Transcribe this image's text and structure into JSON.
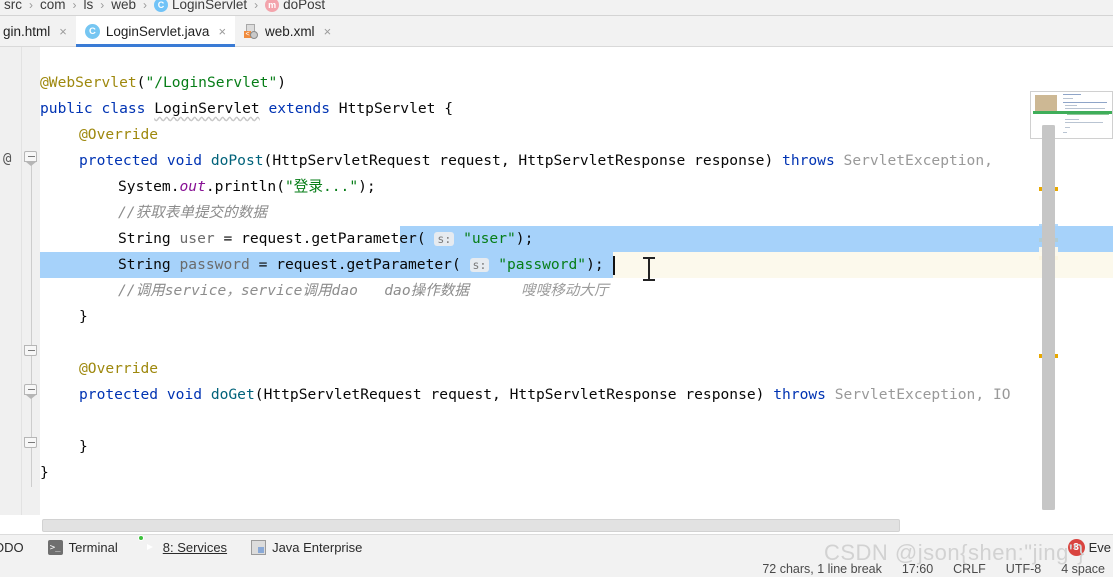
{
  "breadcrumb": {
    "items": [
      {
        "label": "src",
        "icon": "none"
      },
      {
        "label": "com",
        "icon": "none"
      },
      {
        "label": "ls",
        "icon": "none"
      },
      {
        "label": "web",
        "icon": "none"
      },
      {
        "label": "LoginServlet",
        "icon": "class-icon",
        "glyph": "C"
      },
      {
        "label": "doPost",
        "icon": "method-icon",
        "glyph": "m"
      }
    ],
    "separator": "›"
  },
  "tabs": [
    {
      "label": "gin.html",
      "icon": "html-file-icon",
      "active": false,
      "close": "×"
    },
    {
      "label": "LoginServlet.java",
      "icon": "java-class-icon",
      "glyph": "C",
      "active": true,
      "close": "×"
    },
    {
      "label": "web.xml",
      "icon": "xml-file-icon",
      "active": false,
      "close": "×"
    }
  ],
  "editor": {
    "annotation_marker": "@",
    "code_lines": [
      "@WebServlet(\"/LoginServlet\")",
      "public class LoginServlet extends HttpServlet {",
      "    @Override",
      "    protected void doPost(HttpServletRequest request, HttpServletResponse response) throws ServletException,",
      "        System.out.println(\"登录...\");",
      "        //获取表单提交的数据",
      "        String user = request.getParameter( s: \"user\");",
      "        String password = request.getParameter( s: \"password\");",
      "        //调用service，service调用dao   dao操作数据",
      "    }",
      "",
      "    @Override",
      "    protected void doGet(HttpServletRequest request, HttpServletResponse response) throws ServletException, IO",
      "",
      "    }",
      "}"
    ],
    "tokens": {
      "annotation_webservlet": "@WebServlet",
      "annotation_override": "@Override",
      "kw_public": "public",
      "kw_class": "class",
      "kw_extends": "extends",
      "kw_protected": "protected",
      "kw_void": "void",
      "kw_throws": "throws",
      "type_loginservlet": "LoginServlet",
      "type_httpservlet": "HttpServlet",
      "type_httpservletrequest": "HttpServletRequest",
      "type_httpservletresponse": "HttpServletResponse",
      "type_servletexception": "ServletException",
      "type_io_truncated": "IO",
      "type_servletexception_truncated_dopost": "ServletException,",
      "method_dopost": "doPost",
      "method_doget": "doGet",
      "method_getparameter": "getParameter",
      "method_println": "println",
      "var_request": "request",
      "var_response": "response",
      "var_user": "user",
      "var_password": "password",
      "var_system": "System",
      "field_out": "out",
      "type_string": "String",
      "str_path": "\"/LoginServlet\"",
      "str_login": "\"登录...\"",
      "str_user": "\"user\"",
      "str_password": "\"password\"",
      "hint_s": "s:",
      "comment_get_form": "//获取表单提交的数据",
      "comment_call_service": "//调用service，service调用dao   dao操作数据",
      "inlay_hint_extra": "嗖嗖移动大厅",
      "brace_open": "{",
      "brace_close": "}",
      "paren_open": "(",
      "paren_close": ")",
      "semicolon": ";",
      "comma": ",",
      "dot": ".",
      "equals": "="
    }
  },
  "toolbar": {
    "items": [
      {
        "label": "ODO",
        "icon": "todo-icon",
        "mnemonic": ""
      },
      {
        "label": "Terminal",
        "icon": "terminal-icon",
        "mnemonic": ""
      },
      {
        "label": "8: Services",
        "icon": "services-run-icon",
        "mnemonic": "8"
      },
      {
        "label": "Java Enterprise",
        "icon": "java-enterprise-icon",
        "mnemonic": ""
      }
    ],
    "right": {
      "event_log_label": "Eve",
      "badge_count": "3"
    }
  },
  "statusbar": {
    "items": [
      {
        "name": "selection-info",
        "value": "72 chars, 1 line break"
      },
      {
        "name": "caret-position",
        "value": "17:60"
      },
      {
        "name": "line-separator",
        "value": "CRLF"
      },
      {
        "name": "file-encoding",
        "value": "UTF-8"
      },
      {
        "name": "indent",
        "value": "4 space"
      }
    ]
  },
  "watermark": {
    "text": "CSDN @json{shen:\"jing\"}"
  },
  "colors": {
    "accent_blue": "#3a7bd5",
    "selection": "#a6d2fa",
    "caret_row": "#fcf9ec",
    "keyword": "#0033b3",
    "string": "#067d17",
    "annotation": "#9e880d",
    "comment": "#8c8c8c",
    "static_field": "#871094",
    "warning_marker": "#e8a800",
    "badge_red": "#d9443f",
    "toolbar_bg": "#f2f2f2"
  }
}
